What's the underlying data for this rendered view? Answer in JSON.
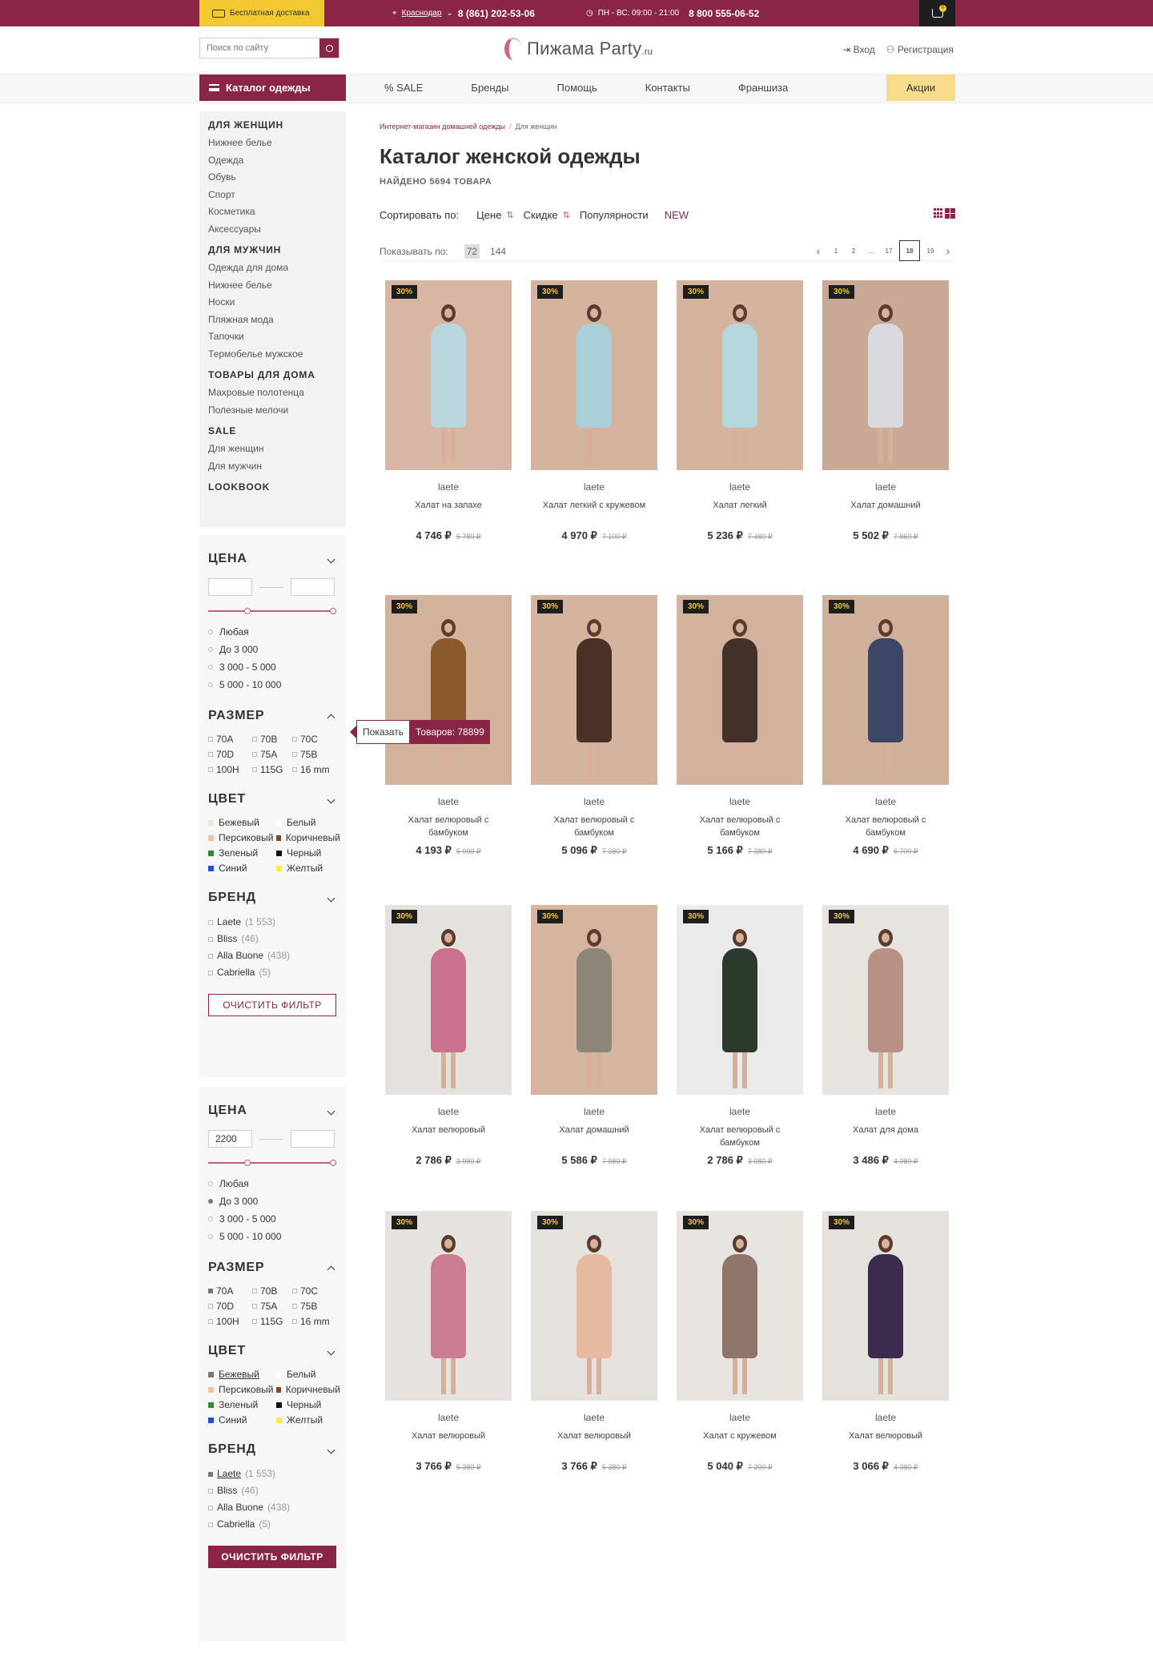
{
  "topbar": {
    "shipping": "Бесплатная доставка",
    "city": "Краснодар",
    "phone1": "8 (861) 202-53-06",
    "hours": "ПН - ВС: 09:00 - 21:00",
    "phone2": "8 800 555-06-52",
    "cart_count": "0"
  },
  "header": {
    "search_placeholder": "Поиск по сайту",
    "logo_main": "Пижама Party",
    "logo_suffix": ".ru",
    "login": "Вход",
    "register": "Регистрация"
  },
  "nav": {
    "catalog": "Каталог одежды",
    "items": [
      "% SALE",
      "Бренды",
      "Помощь",
      "Контакты",
      "Франшиза"
    ],
    "promo": "Акции"
  },
  "sidebar": {
    "groups": [
      {
        "title": "ДЛЯ ЖЕНЩИН",
        "items": [
          "Нижнее белье",
          "Одежда",
          "Обувь",
          "Спорт",
          "Косметика",
          "Аксессуары"
        ]
      },
      {
        "title": "ДЛЯ МУЖЧИН",
        "items": [
          "Одежда для дома",
          "Нижнее белье",
          "Носки",
          "Пляжная мода",
          "Тапочки",
          "Термобелье мужское"
        ]
      },
      {
        "title": "ТОВАРЫ ДЛЯ ДОМА",
        "items": [
          "Махровые полотенца",
          "Полезные мелочи"
        ]
      },
      {
        "title": "SALE",
        "items": [
          "Для женщин",
          "Для мужчин"
        ]
      },
      {
        "title": "LOOKBOOK",
        "items": []
      }
    ]
  },
  "filters": [
    {
      "price_title": "ЦЕНА",
      "price_from": "",
      "price_to": "",
      "price_options": [
        "Любая",
        "До 3 000",
        "3 000 - 5 000",
        "5 000 - 10 000"
      ],
      "price_selected": -1,
      "size_title": "РАЗМЕР",
      "sizes": [
        "70A",
        "70B",
        "70C",
        "70D",
        "75A",
        "75B",
        "100H",
        "115G",
        "16 mm"
      ],
      "size_selected": -1,
      "color_title": "ЦВЕТ",
      "colors": [
        {
          "name": "Бежевый",
          "hex": "#f3e3d3"
        },
        {
          "name": "Белый",
          "hex": "#ffffff"
        },
        {
          "name": "Персиковый",
          "hex": "#f5c39a"
        },
        {
          "name": "Коричневый",
          "hex": "#7a4a24"
        },
        {
          "name": "Зеленый",
          "hex": "#2f8a2a"
        },
        {
          "name": "Черный",
          "hex": "#111111"
        },
        {
          "name": "Синий",
          "hex": "#1f4fd6"
        },
        {
          "name": "Желтый",
          "hex": "#f4f03a"
        }
      ],
      "color_selected": -1,
      "brand_title": "БРЕНД",
      "brands": [
        {
          "name": "Laete",
          "count": "(1 553)"
        },
        {
          "name": "Bliss",
          "count": "(46)"
        },
        {
          "name": "Alla Buone",
          "count": "(438)"
        },
        {
          "name": "Cabriella",
          "count": "(5)"
        }
      ],
      "brand_selected": -1,
      "clear": "ОЧИСТИТЬ ФИЛЬТР"
    },
    {
      "price_title": "ЦЕНА",
      "price_from": "2200",
      "price_to": "",
      "price_options": [
        "Любая",
        "До 3 000",
        "3 000 - 5 000",
        "5 000 - 10 000"
      ],
      "price_selected": 1,
      "size_title": "РАЗМЕР",
      "sizes": [
        "70A",
        "70B",
        "70C",
        "70D",
        "75A",
        "75B",
        "100H",
        "115G",
        "16 mm"
      ],
      "size_selected": 0,
      "color_title": "ЦВЕТ",
      "colors": [
        {
          "name": "Бежевый",
          "hex": "#777777"
        },
        {
          "name": "Белый",
          "hex": "#ffffff"
        },
        {
          "name": "Персиковый",
          "hex": "#f5c39a"
        },
        {
          "name": "Коричневый",
          "hex": "#7a4a24"
        },
        {
          "name": "Зеленый",
          "hex": "#2f8a2a"
        },
        {
          "name": "Черный",
          "hex": "#111111"
        },
        {
          "name": "Синий",
          "hex": "#1f4fd6"
        },
        {
          "name": "Желтый",
          "hex": "#f4f03a"
        }
      ],
      "color_selected": 0,
      "brand_title": "БРЕНД",
      "brands": [
        {
          "name": "Laete",
          "count": "(1 553)"
        },
        {
          "name": "Bliss",
          "count": "(46)"
        },
        {
          "name": "Alla Buone",
          "count": "(438)"
        },
        {
          "name": "Cabriella",
          "count": "(5)"
        }
      ],
      "brand_selected": 0,
      "clear": "ОЧИСТИТЬ ФИЛЬТР"
    }
  ],
  "tooltip": {
    "show": "Показать",
    "count": "Товаров: 78899"
  },
  "main": {
    "crumb_home": "Интернет-магазин домашней одежды",
    "crumb_sep": "/",
    "crumb_current": "Для женщин",
    "title": "Каталог женской одежды",
    "found": "НАЙДЕНО 5694 ТОВАРА",
    "sort_label": "Сортировать по:",
    "sort_price": "Цене",
    "sort_discount": "Скидке",
    "sort_popular": "Популярности",
    "sort_new": "NEW",
    "show_label": "Показывать по:",
    "show_opts": [
      "72",
      "144"
    ],
    "pages": [
      "1",
      "2",
      "...",
      "17",
      "18",
      "19"
    ],
    "current_page": "18"
  },
  "colors": {
    "brand": "#8a2548",
    "accent": "#f3c931",
    "promo": "#f7dc8c"
  },
  "products": [
    {
      "badge": "30%",
      "brand": "laete",
      "name": "Халат на запахе",
      "price": "4 746 ₽",
      "old": "6 780 ₽",
      "bg": "#d7b7a3",
      "cloth": "#b9d6df"
    },
    {
      "badge": "30%",
      "brand": "laete",
      "name": "Халат легкий с кружевом",
      "price": "4 970 ₽",
      "old": "7 100 ₽",
      "bg": "#d3b39d",
      "cloth": "#a9cfd8"
    },
    {
      "badge": "30%",
      "brand": "laete",
      "name": "Халат легкий",
      "price": "5 236 ₽",
      "old": "7 480 ₽",
      "bg": "#d5b49f",
      "cloth": "#b4d7dd"
    },
    {
      "badge": "30%",
      "brand": "laete",
      "name": "Халат домашний",
      "price": "5 502 ₽",
      "old": "7 860 ₽",
      "bg": "#c9a996",
      "cloth": "#d9d9de"
    },
    {
      "badge": "30%",
      "brand": "laete",
      "name": "Халат велюровый с бамбуком",
      "price": "4 193 ₽",
      "old": "5 990 ₽",
      "bg": "#d3b29b",
      "cloth": "#8a5a2b"
    },
    {
      "badge": "30%",
      "brand": "laete",
      "name": "Халат велюровый с бамбуком",
      "price": "5 096 ₽",
      "old": "7 280 ₽",
      "bg": "#d4b49e",
      "cloth": "#4a3128"
    },
    {
      "badge": "30%",
      "brand": "laete",
      "name": "Халат велюровый с бамбуком",
      "price": "5 166 ₽",
      "old": "7 380 ₽",
      "bg": "#d2b29c",
      "cloth": "#43302a"
    },
    {
      "badge": "30%",
      "brand": "laete",
      "name": "Халат велюровый с бамбуком",
      "price": "4 690 ₽",
      "old": "6 700 ₽",
      "bg": "#d0b19c",
      "cloth": "#3c4766"
    },
    {
      "badge": "30%",
      "brand": "laete",
      "name": "Халат велюровый",
      "price": "2 786 ₽",
      "old": "3 980 ₽",
      "bg": "#e5e1dc",
      "cloth": "#c9718f"
    },
    {
      "badge": "30%",
      "brand": "laete",
      "name": "Халат домашний",
      "price": "5 586 ₽",
      "old": "7 980 ₽",
      "bg": "#d5b59f",
      "cloth": "#8d8577"
    },
    {
      "badge": "30%",
      "brand": "laete",
      "name": "Халат велюровый с бамбуком",
      "price": "2 786 ₽",
      "old": "3 980 ₽",
      "bg": "#ebebeb",
      "cloth": "#2c3a2e"
    },
    {
      "badge": "30%",
      "brand": "laete",
      "name": "Халат для дома",
      "price": "3 486 ₽",
      "old": "4 980 ₽",
      "bg": "#e7e4e0",
      "cloth": "#b89084"
    },
    {
      "badge": "30%",
      "brand": "laete",
      "name": "Халат велюровый",
      "price": "3 766 ₽",
      "old": "5 380 ₽",
      "bg": "#e6e3df",
      "cloth": "#c97c92"
    },
    {
      "badge": "30%",
      "brand": "laete",
      "name": "Халат велюровый",
      "price": "3 766 ₽",
      "old": "5 380 ₽",
      "bg": "#e5e2de",
      "cloth": "#e6b9a1"
    },
    {
      "badge": "30%",
      "brand": "laete",
      "name": "Халат с кружевом",
      "price": "5 040 ₽",
      "old": "7 200 ₽",
      "bg": "#e8e5e1",
      "cloth": "#8f7569"
    },
    {
      "badge": "30%",
      "brand": "laete",
      "name": "Халат велюровый",
      "price": "3 066 ₽",
      "old": "4 380 ₽",
      "bg": "#e5e2de",
      "cloth": "#3a2b4f"
    }
  ]
}
